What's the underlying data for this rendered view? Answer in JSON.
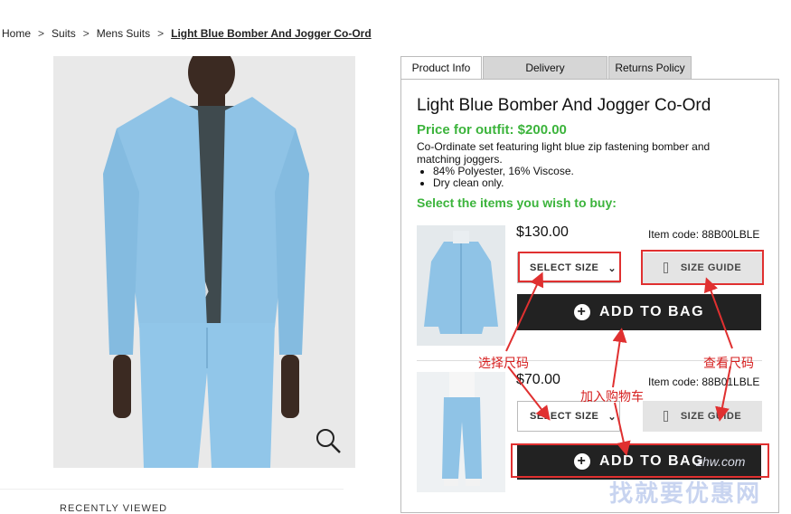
{
  "breadcrumb": {
    "items": [
      "Home",
      "Suits",
      "Mens Suits"
    ],
    "current": "Light Blue Bomber And Jogger Co-Ord"
  },
  "recently_viewed": "RECENTLY VIEWED",
  "tabs": [
    "Product Info",
    "Delivery",
    "Returns Policy"
  ],
  "product": {
    "title": "Light Blue Bomber And Jogger Co-Ord",
    "price": "Price for outfit: $200.00",
    "description": "Co-Ordinate set featuring light blue zip fastening bomber and matching joggers.",
    "features": [
      "84% Polyester, 16% Viscose.",
      "Dry clean only."
    ],
    "select_prompt": "Select the items you wish to buy:"
  },
  "items": [
    {
      "price": "$130.00",
      "code": "Item code: 88B00LBLE",
      "select_label": "SELECT SIZE",
      "guide_label": "SIZE GUIDE",
      "bag_label": "ADD TO BAG"
    },
    {
      "price": "$70.00",
      "code": "Item code: 88B01LBLE",
      "select_label": "SELECT SIZE",
      "guide_label": "SIZE GUIDE",
      "bag_label": "ADD TO BAG"
    }
  ],
  "annotations": {
    "select_size": "选择尺码",
    "add_to_bag": "加入购物车",
    "size_guide": "查看尺码"
  },
  "watermark": {
    "text": "找就要优惠网",
    "url": "zhw.com"
  },
  "colors": {
    "accent_green": "#3cb43c",
    "annotation_red": "#e03030",
    "bag_button": "#222222",
    "product_blue": "#8ec4e8"
  }
}
